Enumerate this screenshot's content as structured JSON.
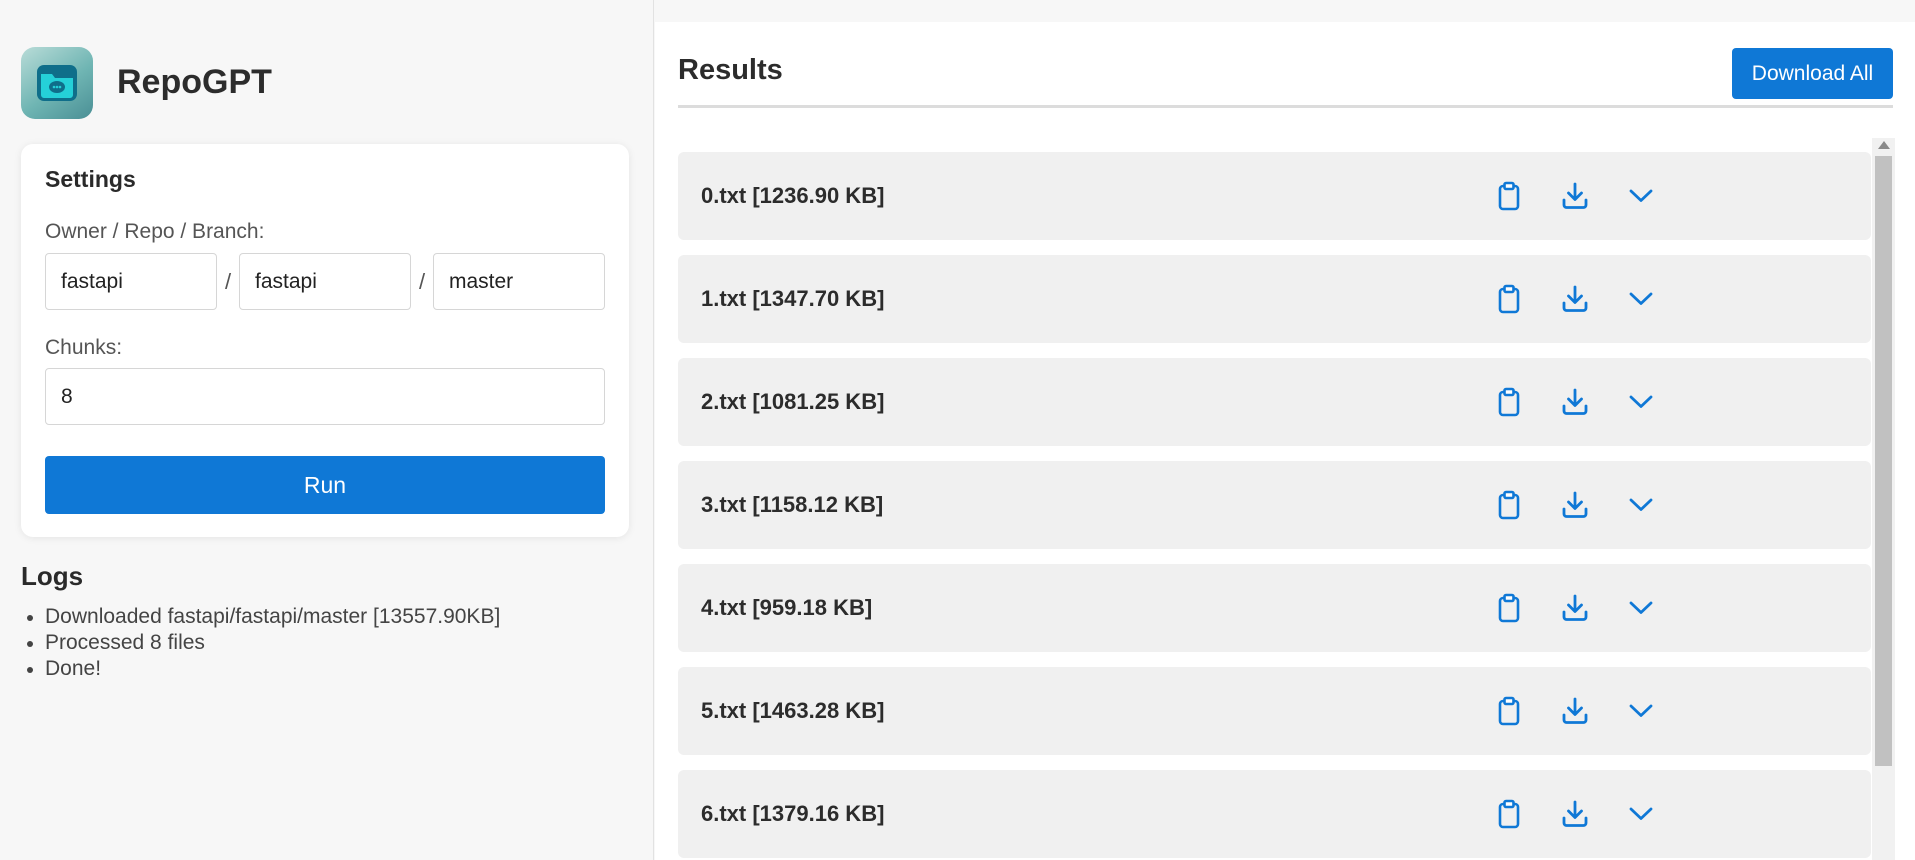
{
  "app": {
    "title": "RepoGPT",
    "logo_icon": "folder-chat-icon"
  },
  "settings": {
    "title": "Settings",
    "repo_label": "Owner / Repo / Branch:",
    "owner_value": "fastapi",
    "repo_value": "fastapi",
    "branch_value": "master",
    "separator": "/",
    "chunks_label": "Chunks:",
    "chunks_value": "8",
    "run_label": "Run"
  },
  "logs": {
    "title": "Logs",
    "items": [
      "Downloaded fastapi/fastapi/master [13557.90KB]",
      "Processed 8 files",
      "Done!"
    ]
  },
  "results": {
    "title": "Results",
    "download_all_label": "Download All",
    "item_icons": [
      "clipboard-icon",
      "download-icon",
      "chevron-down-icon"
    ],
    "items": [
      {
        "name": "0.txt [1236.90 KB]"
      },
      {
        "name": "1.txt [1347.70 KB]"
      },
      {
        "name": "2.txt [1081.25 KB]"
      },
      {
        "name": "3.txt [1158.12 KB]"
      },
      {
        "name": "4.txt [959.18 KB]"
      },
      {
        "name": "5.txt [1463.28 KB]"
      },
      {
        "name": "6.txt [1379.16 KB]"
      }
    ]
  },
  "colors": {
    "accent": "#0f78d6",
    "row_background": "#f0f0f0",
    "panel_background": "#f7f7f7"
  }
}
